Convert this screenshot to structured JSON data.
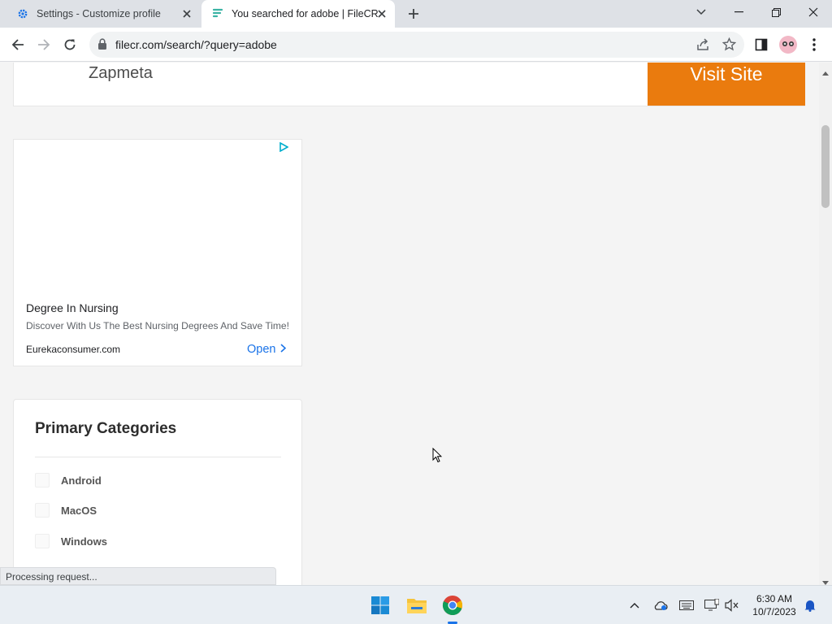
{
  "browser": {
    "tabs": [
      {
        "title": "Settings - Customize profile",
        "active": false
      },
      {
        "title": "You searched for adobe | FileCR",
        "active": true
      }
    ],
    "url": "filecr.com/search/?query=adobe"
  },
  "top_ad": {
    "brand": "Zapmeta",
    "button_label": "Visit Site"
  },
  "side_ad": {
    "title": "Degree In Nursing",
    "description": "Discover With Us The Best Nursing Degrees And Save Time!",
    "domain": "Eurekaconsumer.com",
    "open_label": "Open"
  },
  "categories": {
    "title": "Primary Categories",
    "items": [
      {
        "label": "Android"
      },
      {
        "label": "MacOS"
      },
      {
        "label": "Windows"
      }
    ]
  },
  "status_text": "Processing request...",
  "taskbar": {
    "time": "6:30 AM",
    "date": "10/7/2023"
  },
  "colors": {
    "visit_button": "#ea7b0e",
    "link": "#1a73e8",
    "tab_strip": "#dee1e6"
  }
}
